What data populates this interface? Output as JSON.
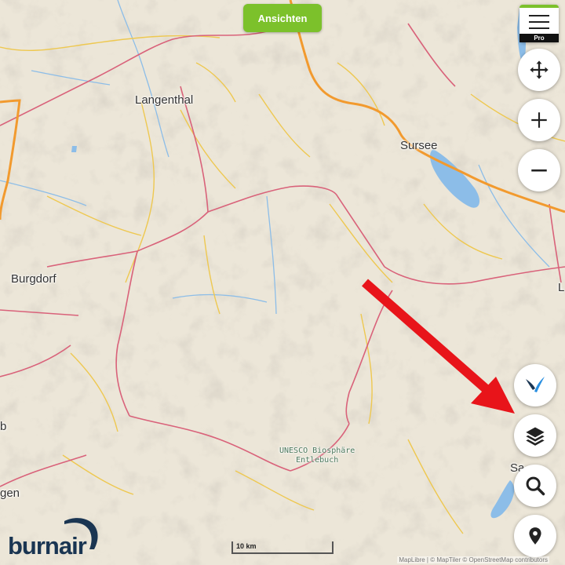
{
  "top_button": {
    "label": "Ansichten"
  },
  "menu": {
    "badge": "Pro",
    "icon": "hamburger-menu-icon"
  },
  "controls": {
    "pan": {
      "icon": "move-arrows-icon"
    },
    "zoom_in": {
      "icon": "plus-icon"
    },
    "zoom_out": {
      "icon": "minus-icon"
    },
    "paraglider": {
      "icon": "paraglider-icon",
      "color": "#2a8fe0"
    },
    "layers": {
      "icon": "layers-icon"
    },
    "search": {
      "icon": "search-icon"
    },
    "location": {
      "icon": "location-pin-icon"
    }
  },
  "places": {
    "langenthal": "Langenthal",
    "sursee": "Sursee",
    "burgdorf": "Burgdorf",
    "l_edge": "L",
    "b_edge": "b",
    "gen_edge": "gen",
    "sarnen_edge": "Sa",
    "unesco_line1": "UNESCO Biosphäre",
    "unesco_line2": "Entlebuch"
  },
  "logo": {
    "text": "burnair"
  },
  "scale": {
    "label": "10 km"
  },
  "attribution": "MapLibre | © MapTiler © OpenStreetMap contributors",
  "annotation": {
    "arrow_color": "#e8141a"
  },
  "colors": {
    "motorway": "#f29a2e",
    "main_road": "#d9627a",
    "minor_road": "#eec850",
    "lake": "#8cbde8",
    "accent": "#7cc12b"
  }
}
